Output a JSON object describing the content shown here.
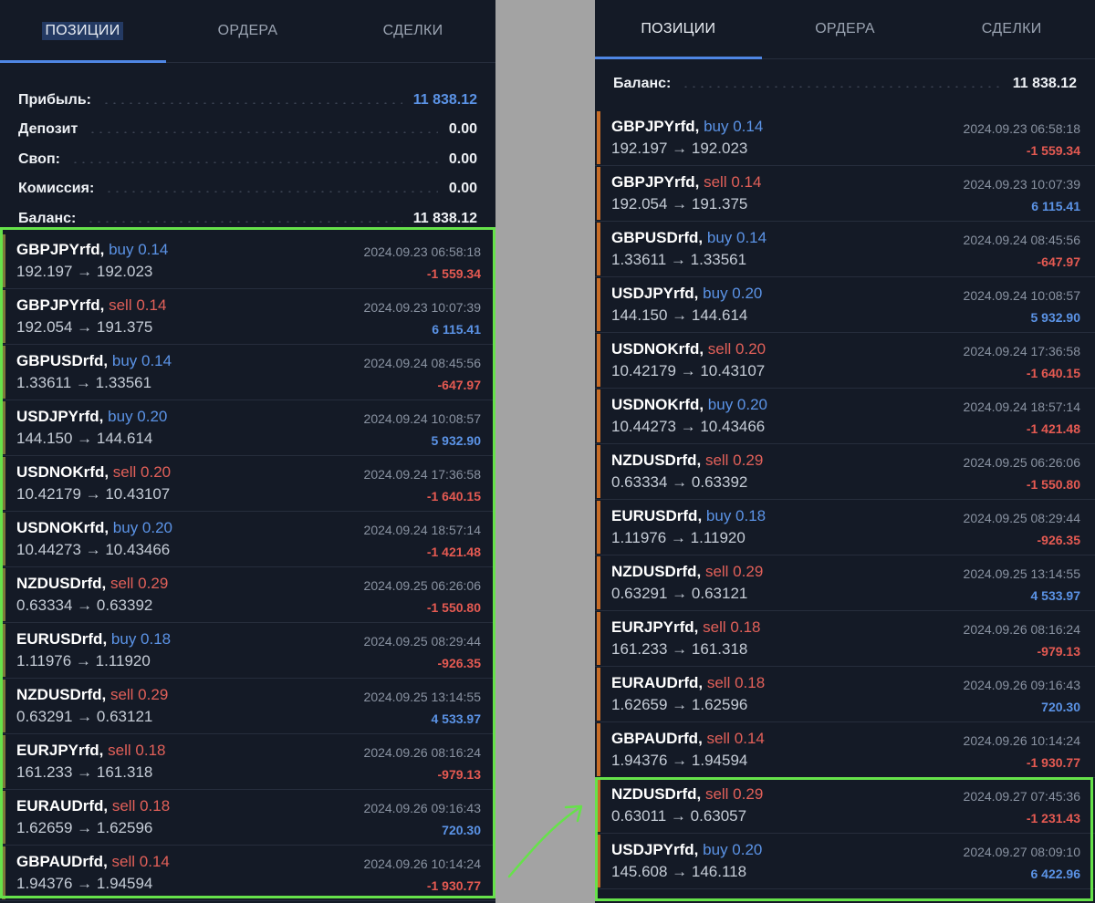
{
  "tabs": {
    "positions": "ПОЗИЦИИ",
    "orders": "ОРДЕРА",
    "deals": "СДЕЛКИ"
  },
  "colors": {
    "accent": "#4f86e4",
    "profit_positive": "#5b93e6",
    "profit_negative": "#e55a52",
    "highlight": "#66e24a",
    "background": "#141a26"
  },
  "left": {
    "summary": [
      {
        "label": "Прибыль:",
        "value": "11 838.12"
      },
      {
        "label": "Депозит",
        "value": "0.00"
      },
      {
        "label": "Своп:",
        "value": "0.00"
      },
      {
        "label": "Комиссия:",
        "value": "0.00"
      },
      {
        "label": "Баланс:",
        "value": "11 838.12"
      }
    ],
    "trades": [
      {
        "symbol": "GBPJPYrfd,",
        "dir": "buy 0.14",
        "price": "192.197 → 192.023",
        "date": "2024.09.23 06:58:18",
        "profit": "-1 559.34"
      },
      {
        "symbol": "GBPJPYrfd,",
        "dir": "sell 0.14",
        "price": "192.054 → 191.375",
        "date": "2024.09.23 10:07:39",
        "profit": "6 115.41"
      },
      {
        "symbol": "GBPUSDrfd,",
        "dir": "buy 0.14",
        "price": "1.33611 → 1.33561",
        "date": "2024.09.24 08:45:56",
        "profit": "-647.97"
      },
      {
        "symbol": "USDJPYrfd,",
        "dir": "buy 0.20",
        "price": "144.150 → 144.614",
        "date": "2024.09.24 10:08:57",
        "profit": "5 932.90"
      },
      {
        "symbol": "USDNOKrfd,",
        "dir": "sell 0.20",
        "price": "10.42179 → 10.43107",
        "date": "2024.09.24 17:36:58",
        "profit": "-1 640.15"
      },
      {
        "symbol": "USDNOKrfd,",
        "dir": "buy 0.20",
        "price": "10.44273 → 10.43466",
        "date": "2024.09.24 18:57:14",
        "profit": "-1 421.48"
      },
      {
        "symbol": "NZDUSDrfd,",
        "dir": "sell 0.29",
        "price": "0.63334 → 0.63392",
        "date": "2024.09.25 06:26:06",
        "profit": "-1 550.80"
      },
      {
        "symbol": "EURUSDrfd,",
        "dir": "buy 0.18",
        "price": "1.11976 → 1.11920",
        "date": "2024.09.25 08:29:44",
        "profit": "-926.35"
      },
      {
        "symbol": "NZDUSDrfd,",
        "dir": "sell 0.29",
        "price": "0.63291 → 0.63121",
        "date": "2024.09.25 13:14:55",
        "profit": "4 533.97"
      },
      {
        "symbol": "EURJPYrfd,",
        "dir": "sell 0.18",
        "price": "161.233 → 161.318",
        "date": "2024.09.26 08:16:24",
        "profit": "-979.13"
      },
      {
        "symbol": "EURAUDrfd,",
        "dir": "sell 0.18",
        "price": "1.62659 → 1.62596",
        "date": "2024.09.26 09:16:43",
        "profit": "720.30"
      },
      {
        "symbol": "GBPAUDrfd,",
        "dir": "sell 0.14",
        "price": "1.94376 → 1.94594",
        "date": "2024.09.26 10:14:24",
        "profit": "-1 930.77"
      }
    ]
  },
  "right": {
    "summary": [
      {
        "label": "Баланс:",
        "value": "11 838.12"
      }
    ],
    "trades": [
      {
        "symbol": "GBPJPYrfd,",
        "dir": "buy 0.14",
        "price": "192.197 → 192.023",
        "date": "2024.09.23 06:58:18",
        "profit": "-1 559.34"
      },
      {
        "symbol": "GBPJPYrfd,",
        "dir": "sell 0.14",
        "price": "192.054 → 191.375",
        "date": "2024.09.23 10:07:39",
        "profit": "6 115.41"
      },
      {
        "symbol": "GBPUSDrfd,",
        "dir": "buy 0.14",
        "price": "1.33611 → 1.33561",
        "date": "2024.09.24 08:45:56",
        "profit": "-647.97"
      },
      {
        "symbol": "USDJPYrfd,",
        "dir": "buy 0.20",
        "price": "144.150 → 144.614",
        "date": "2024.09.24 10:08:57",
        "profit": "5 932.90"
      },
      {
        "symbol": "USDNOKrfd,",
        "dir": "sell 0.20",
        "price": "10.42179 → 10.43107",
        "date": "2024.09.24 17:36:58",
        "profit": "-1 640.15"
      },
      {
        "symbol": "USDNOKrfd,",
        "dir": "buy 0.20",
        "price": "10.44273 → 10.43466",
        "date": "2024.09.24 18:57:14",
        "profit": "-1 421.48"
      },
      {
        "symbol": "NZDUSDrfd,",
        "dir": "sell 0.29",
        "price": "0.63334 → 0.63392",
        "date": "2024.09.25 06:26:06",
        "profit": "-1 550.80"
      },
      {
        "symbol": "EURUSDrfd,",
        "dir": "buy 0.18",
        "price": "1.11976 → 1.11920",
        "date": "2024.09.25 08:29:44",
        "profit": "-926.35"
      },
      {
        "symbol": "NZDUSDrfd,",
        "dir": "sell 0.29",
        "price": "0.63291 → 0.63121",
        "date": "2024.09.25 13:14:55",
        "profit": "4 533.97"
      },
      {
        "symbol": "EURJPYrfd,",
        "dir": "sell 0.18",
        "price": "161.233 → 161.318",
        "date": "2024.09.26 08:16:24",
        "profit": "-979.13"
      },
      {
        "symbol": "EURAUDrfd,",
        "dir": "sell 0.18",
        "price": "1.62659 → 1.62596",
        "date": "2024.09.26 09:16:43",
        "profit": "720.30"
      },
      {
        "symbol": "GBPAUDrfd,",
        "dir": "sell 0.14",
        "price": "1.94376 → 1.94594",
        "date": "2024.09.26 10:14:24",
        "profit": "-1 930.77"
      },
      {
        "symbol": "NZDUSDrfd,",
        "dir": "sell 0.29",
        "price": "0.63011 → 0.63057",
        "date": "2024.09.27 07:45:36",
        "profit": "-1 231.43"
      },
      {
        "symbol": "USDJPYrfd,",
        "dir": "buy 0.20",
        "price": "145.608 → 146.118",
        "date": "2024.09.27 08:09:10",
        "profit": "6 422.96"
      }
    ]
  }
}
